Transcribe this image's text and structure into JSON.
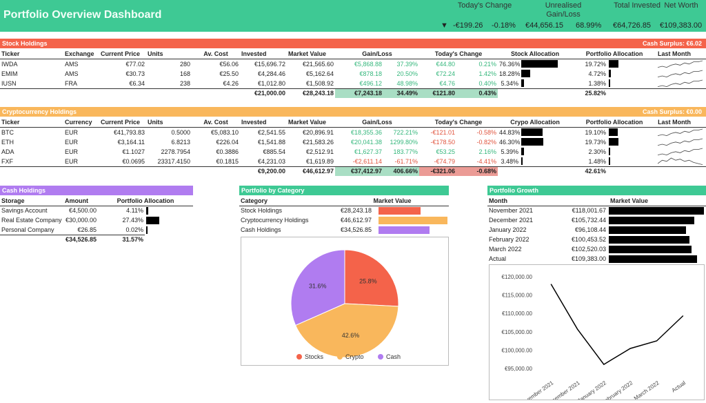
{
  "header": {
    "title": "Portfolio Overview Dashboard",
    "labels": {
      "todays_change": "Today's Change",
      "unrealised": "Unrealised Gain/Loss",
      "total_invested": "Total Invested",
      "net_worth": "Net Worth"
    },
    "direction_icon": "triangle-down-icon",
    "direction_glyph": "▼",
    "todays_change_value": "-€199.26",
    "todays_change_pct": "-0.18%",
    "unrealised_value": "€44,656.15",
    "unrealised_pct": "68.99%",
    "total_invested": "€64,726.85",
    "net_worth": "€109,383.00"
  },
  "colors": {
    "header": "#3ec994",
    "stock": "#f4634a",
    "crypto": "#f9b75c",
    "cash": "#b07cf0",
    "gain": "#35b77c",
    "loss": "#e0533d"
  },
  "stocks": {
    "title": "Stock Holdings",
    "surplus": "Cash Surplus:  €6.02",
    "columns": [
      "Ticker",
      "Exchange",
      "Current Price",
      "Units",
      "Av. Cost",
      "Invested",
      "Market Value",
      "Gain/Loss",
      "Today's Change",
      "Stock Allocation",
      "Portfolio Allocation",
      "Last Month"
    ],
    "rows": [
      {
        "ticker": "IWDA",
        "exchange": "AMS",
        "price": "€77.02",
        "units": "280",
        "avcost": "€56.06",
        "invested": "€15,696.72",
        "mv": "€21,565.60",
        "gain": "€5,868.88",
        "gain_pct": "37.39%",
        "today": "€44.80",
        "today_pct": "0.21%",
        "alloc": "76.36%",
        "alloc_v": 76.36,
        "palloc": "19.72%",
        "palloc_v": 19.72,
        "trend": "up"
      },
      {
        "ticker": "EMIM",
        "exchange": "AMS",
        "price": "€30.73",
        "units": "168",
        "avcost": "€25.50",
        "invested": "€4,284.46",
        "mv": "€5,162.64",
        "gain": "€878.18",
        "gain_pct": "20.50%",
        "today": "€72.24",
        "today_pct": "1.42%",
        "alloc": "18.28%",
        "alloc_v": 18.28,
        "palloc": "4.72%",
        "palloc_v": 4.72,
        "trend": "up"
      },
      {
        "ticker": "IUSN",
        "exchange": "FRA",
        "price": "€6.34",
        "units": "238",
        "avcost": "€4.26",
        "invested": "€1,012.80",
        "mv": "€1,508.92",
        "gain": "€496.12",
        "gain_pct": "48.98%",
        "today": "€4.76",
        "today_pct": "0.40%",
        "alloc": "5.34%",
        "alloc_v": 5.34,
        "palloc": "1.38%",
        "palloc_v": 1.38,
        "trend": "up"
      }
    ],
    "total": {
      "invested": "€21,000.00",
      "mv": "€28,243.18",
      "gain": "€7,243.18",
      "gain_pct": "34.49%",
      "today": "€121.80",
      "today_pct": "0.43%",
      "palloc": "25.82%"
    }
  },
  "crypto": {
    "title": "Cryptocurrency Holdings",
    "surplus": "Cash Surplus:  €0.00",
    "columns": [
      "Ticker",
      "Currency",
      "Current Price",
      "Units",
      "Av. Cost",
      "Invested",
      "Market Value",
      "Gain/Loss",
      "Today's Change",
      "Crypo Allocation",
      "Portfolio Allocation",
      "Last Month"
    ],
    "rows": [
      {
        "ticker": "BTC",
        "exchange": "EUR",
        "price": "€41,793.83",
        "units": "0.5000",
        "avcost": "€5,083.10",
        "invested": "€2,541.55",
        "mv": "€20,896.91",
        "gain": "€18,355.36",
        "gain_pct": "722.21%",
        "today": "-€121.01",
        "today_pct": "-0.58%",
        "alloc": "44.83%",
        "alloc_v": 44.83,
        "palloc": "19.10%",
        "palloc_v": 19.1,
        "trend": "up"
      },
      {
        "ticker": "ETH",
        "exchange": "EUR",
        "price": "€3,164.11",
        "units": "6.8213",
        "avcost": "€226.04",
        "invested": "€1,541.88",
        "mv": "€21,583.26",
        "gain": "€20,041.38",
        "gain_pct": "1299.80%",
        "today": "-€178.50",
        "today_pct": "-0.82%",
        "alloc": "46.30%",
        "alloc_v": 46.3,
        "palloc": "19.73%",
        "palloc_v": 19.73,
        "trend": "up"
      },
      {
        "ticker": "ADA",
        "exchange": "EUR",
        "price": "€1.1027",
        "units": "2278.7954",
        "avcost": "€0.3886",
        "invested": "€885.54",
        "mv": "€2,512.91",
        "gain": "€1,627.37",
        "gain_pct": "183.77%",
        "today": "€53.25",
        "today_pct": "2.16%",
        "alloc": "5.39%",
        "alloc_v": 5.39,
        "palloc": "2.30%",
        "palloc_v": 2.3,
        "trend": "up"
      },
      {
        "ticker": "FXF",
        "exchange": "EUR",
        "price": "€0.0695",
        "units": "23317.4150",
        "avcost": "€0.1815",
        "invested": "€4,231.03",
        "mv": "€1,619.89",
        "gain": "-€2,611.14",
        "gain_pct": "-61.71%",
        "today": "-€74.79",
        "today_pct": "-4.41%",
        "alloc": "3.48%",
        "alloc_v": 3.48,
        "palloc": "1.48%",
        "palloc_v": 1.48,
        "trend": "down"
      }
    ],
    "total": {
      "invested": "€9,200.00",
      "mv": "€46,612.97",
      "gain": "€37,412.97",
      "gain_pct": "406.66%",
      "today": "-€321.06",
      "today_pct": "-0.68%",
      "palloc": "42.61%"
    }
  },
  "cash": {
    "title": "Cash Holdings",
    "columns": [
      "Storage",
      "Amount",
      "Portfolio Allocation"
    ],
    "rows": [
      {
        "storage": "Savings Account",
        "amount": "€4,500.00",
        "pct": "4.11%",
        "v": 4.11
      },
      {
        "storage": "Real Estate Company",
        "amount": "€30,000.00",
        "pct": "27.43%",
        "v": 27.43
      },
      {
        "storage": "Personal Company",
        "amount": "€26.85",
        "pct": "0.02%",
        "v": 0.02
      }
    ],
    "total": {
      "amount": "€34,526.85",
      "pct": "31.57%"
    }
  },
  "category": {
    "title": "Portfolio by Category",
    "columns": [
      "Category",
      "Market Value"
    ],
    "rows": [
      {
        "name": "Stock Holdings",
        "mv": "€28,243.18",
        "v": 28243.18,
        "color": "#f4634a"
      },
      {
        "name": "Cryptocurrency Holdings",
        "mv": "€46,612.97",
        "v": 46612.97,
        "color": "#f9b75c"
      },
      {
        "name": "Cash Holdings",
        "mv": "€34,526.85",
        "v": 34526.85,
        "color": "#b07cf0"
      }
    ]
  },
  "growth": {
    "title": "Portfolio Growth",
    "columns": [
      "Month",
      "Market Value"
    ],
    "rows": [
      {
        "month": "November 2021",
        "mv": "€118,001.67",
        "v": 118001.67
      },
      {
        "month": "December 2021",
        "mv": "€105,732.44",
        "v": 105732.44
      },
      {
        "month": "January 2022",
        "mv": "€96,108.44",
        "v": 96108.44
      },
      {
        "month": "February 2022",
        "mv": "€100,453.52",
        "v": 100453.52
      },
      {
        "month": "March 2022",
        "mv": "€102,520.03",
        "v": 102520.03
      },
      {
        "month": "Actual",
        "mv": "€109,383.00",
        "v": 109383.0
      }
    ]
  },
  "chart_data": [
    {
      "type": "pie",
      "slices": [
        {
          "name": "Stocks",
          "value": 25.8,
          "label": "25.8%",
          "color": "#f4634a"
        },
        {
          "name": "Crypto",
          "value": 42.6,
          "label": "42.6%",
          "color": "#f9b75c"
        },
        {
          "name": "Cash",
          "value": 31.6,
          "label": "31.6%",
          "color": "#b07cf0"
        }
      ],
      "legend": "bottom"
    },
    {
      "type": "line",
      "categories": [
        "November 2021",
        "December 2021",
        "January 2022",
        "February 2022",
        "March 2022",
        "Actual"
      ],
      "values": [
        118001.67,
        105732.44,
        96108.44,
        100453.52,
        102520.03,
        109383.0
      ],
      "ylim": [
        95000,
        120000
      ],
      "yticks": [
        "€95,000.00",
        "€100,000.00",
        "€105,000.00",
        "€110,000.00",
        "€115,000.00",
        "€120,000.00"
      ],
      "color": "#000000",
      "grid": false
    }
  ]
}
